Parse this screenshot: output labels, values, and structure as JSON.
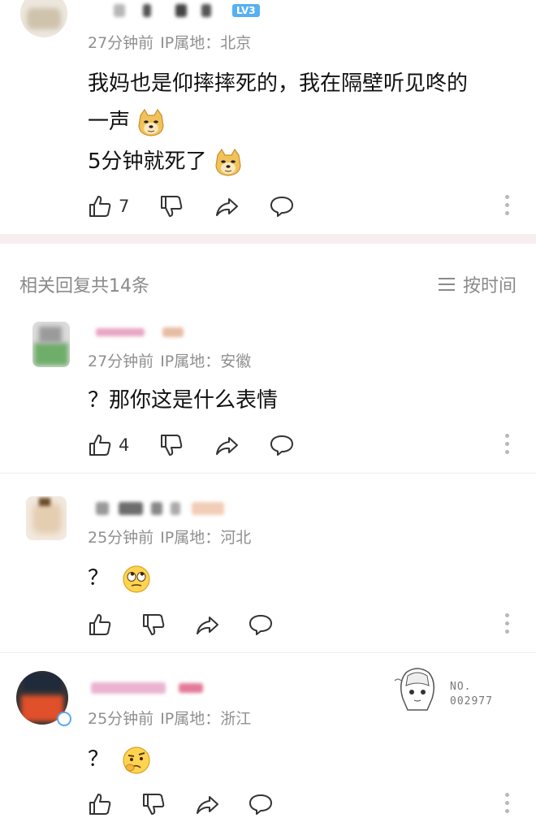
{
  "main_comment": {
    "level_badge": "LV3",
    "time": "27分钟前",
    "ip_label": "IP属地：",
    "ip_location": "北京",
    "text_line1": "我妈也是仰摔摔死的，我在隔壁听见咚的",
    "text_line2": "一声",
    "text_line3": "5分钟就死了",
    "emoji": "doge-emoji",
    "like_count": "7"
  },
  "replies_header": {
    "count_label": "相关回复共14条",
    "sort_label": "按时间",
    "sort_icon": "menu-lines-icon"
  },
  "replies": [
    {
      "time": "27分钟前",
      "ip_label": "IP属地：",
      "ip_location": "安徽",
      "text": "？那你这是什么表情",
      "like_count": "4"
    },
    {
      "time": "25分钟前",
      "ip_label": "IP属地：",
      "ip_location": "河北",
      "text": "？",
      "emoji": "rolling-eyes-emoji",
      "like_count": ""
    },
    {
      "time": "25分钟前",
      "ip_label": "IP属地：",
      "ip_location": "浙江",
      "text": "？",
      "emoji": "skeptical-emoji",
      "like_count": "",
      "badge_no_label": "NO.",
      "badge_number": "002977"
    }
  ],
  "colors": {
    "section_separator": "#f7eef0",
    "meta_gray": "#8f8f8f",
    "level_blue": "#57b0f0"
  }
}
